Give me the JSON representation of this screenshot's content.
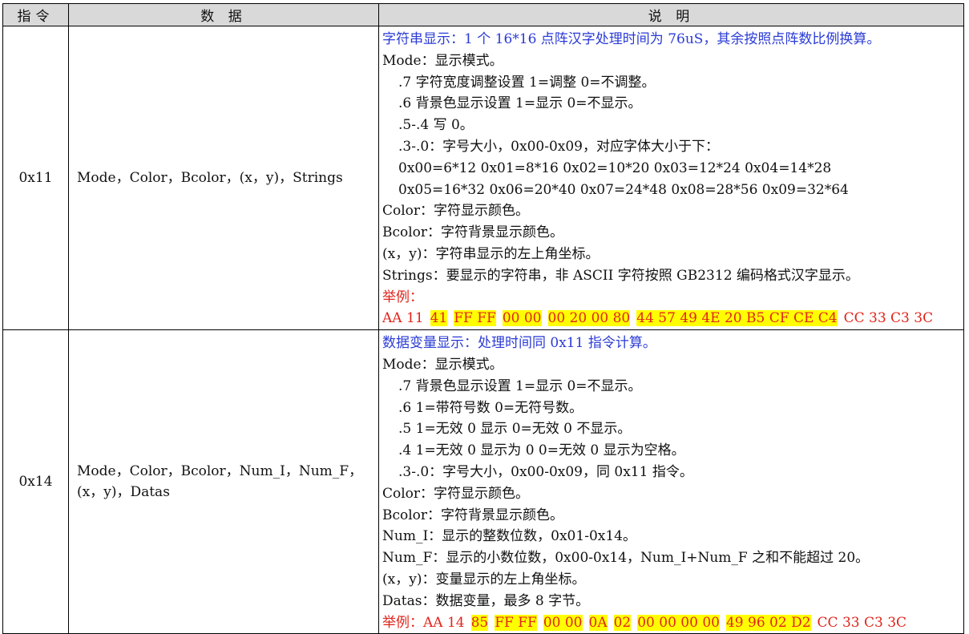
{
  "headers": {
    "cmd": "指令",
    "data": "数 据",
    "desc": "说 明"
  },
  "rows": [
    {
      "code": "0x11",
      "data": "Mode，Color，Bcolor，(x，y)，Strings",
      "lines": [
        "字符串显示：1 个 16*16 点阵汉字处理时间为 76uS，其余按照点阵数比例换算。",
        "Mode：显示模式。",
        ".7 字符宽度调整设置  1=调整 0=不调整。",
        ".6 背景色显示设置    1=显示  0=不显示。",
        ".5-.4 写 0。",
        ".3-.0：字号大小，0x00-0x09，对应字体大小于下：",
        "0x00=6*12  0x01=8*16  0x02=10*20 0x03=12*24 0x04=14*28",
        "0x05=16*32 0x06=20*40 0x07=24*48 0x08=28*56 0x09=32*64",
        "Color：字符显示颜色。",
        "Bcolor：字符背景显示颜色。",
        "(x，y)：字符串显示的左上角坐标。",
        "Strings：要显示的字符串，非 ASCII 字符按照 GB2312 编码格式汉字显示。",
        "举例："
      ],
      "example_prefix": "",
      "example_plain_start": "AA 11",
      "example_highlight": [
        "41",
        "FF FF",
        "00 00",
        "00 20 00 80",
        "44 57 49 4E 20 B5 CF CE C4"
      ],
      "example_plain_end": "CC 33 C3 3C"
    },
    {
      "code": "0x14",
      "data_line1": "Mode，Color，Bcolor，Num_I，Num_F，",
      "data_line2": "(x，y)，Datas",
      "lines": [
        "数据变量显示：处理时间同 0x11 指令计算。",
        "Mode：显示模式。",
        ".7 背景色显示设置  1=显示  0=不显示。",
        ".6 1=带符号数  0=无符号数。",
        ".5 1=无效 0 显示  0=无效 0 不显示。",
        ".4 1=无效 0 显示为 0 0=无效 0 显示为空格。",
        ".3-.0：字号大小，0x00-0x09，同 0x11 指令。",
        "Color：字符显示颜色。",
        "Bcolor：字符背景显示颜色。",
        "Num_I：显示的整数位数，0x01-0x14。",
        "Num_F：显示的小数位数，0x00-0x14，Num_I+Num_F 之和不能超过 20。",
        "(x，y)：变量显示的左上角坐标。",
        "Datas：数据变量，最多 8 字节。"
      ],
      "example_prefix": "举例：",
      "example_plain_start": "AA 14",
      "example_highlight": [
        "85",
        "FF FF",
        "00 00",
        "0A",
        "02",
        "00 00 00 00",
        "49 96 02 D2"
      ],
      "example_plain_end": "CC 33 C3 3C"
    }
  ],
  "colors": {
    "header_bg": "#d9d9d9",
    "title_text": "#2b3bd6",
    "example_text": "#e0241b",
    "highlight": "#ffff00"
  }
}
